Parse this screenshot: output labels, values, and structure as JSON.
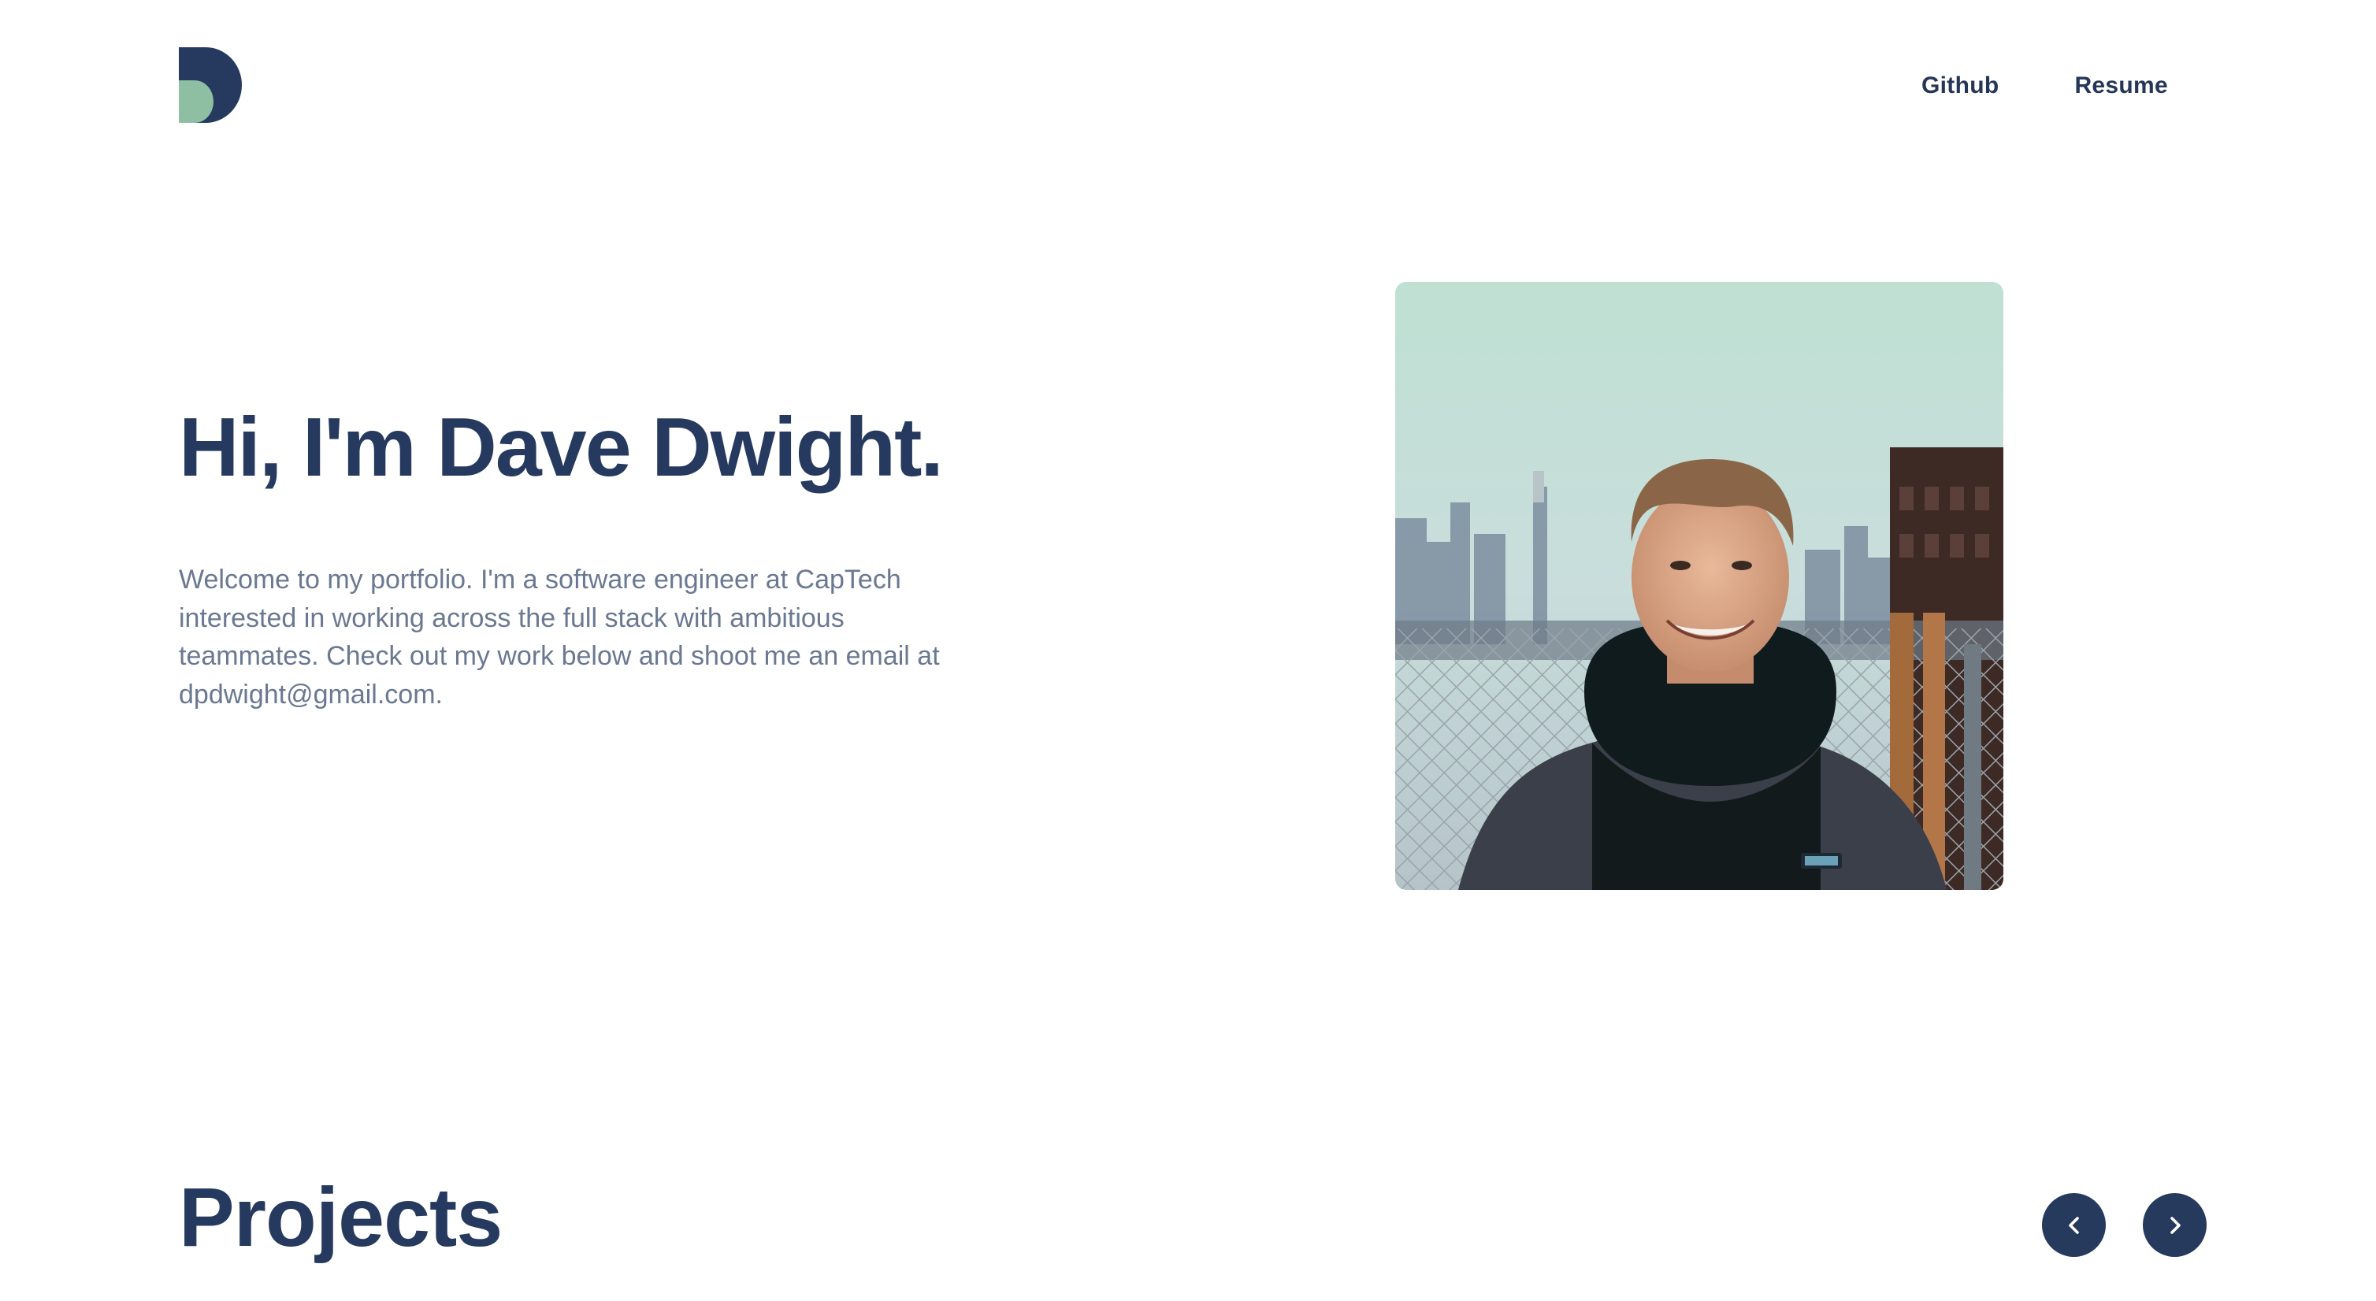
{
  "header": {
    "nav": [
      {
        "label": "Github"
      },
      {
        "label": "Resume"
      }
    ]
  },
  "hero": {
    "title": "Hi, I'm Dave Dwight.",
    "intro": "Welcome to my portfolio. I'm a software engineer at CapTech interested in working across the full stack with ambitious teammates. Check out my work below and shoot me an email at dpdwight@gmail.com."
  },
  "projects": {
    "title": "Projects",
    "prev_icon": "chevron-left-icon",
    "next_icon": "chevron-right-icon"
  },
  "colors": {
    "brand_navy": "#263a60",
    "brand_sage": "#8fbfa3",
    "body_text": "#6a7891"
  }
}
